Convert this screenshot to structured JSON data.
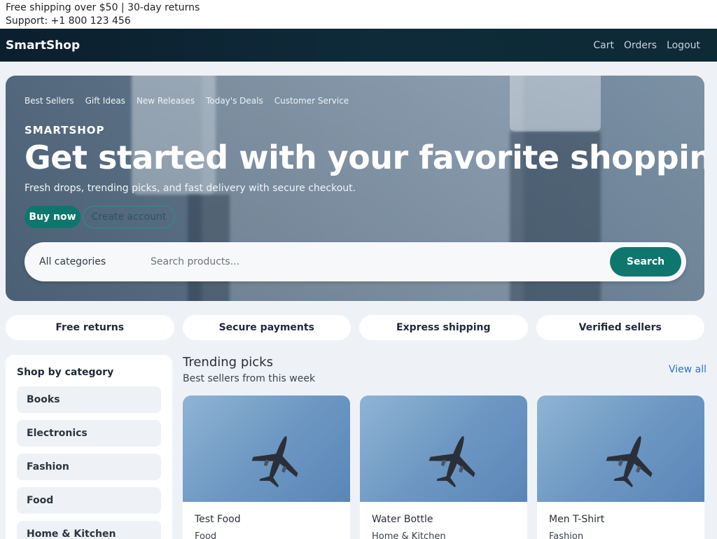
{
  "topinfo": {
    "line1": "Free shipping over $50 | 30-day returns",
    "line2": "Support: +1 800 123 456"
  },
  "navbar": {
    "brand": "SmartShop",
    "links": [
      "Cart",
      "Orders",
      "Logout"
    ]
  },
  "hero": {
    "links": [
      "Best Sellers",
      "Gift Ideas",
      "New Releases",
      "Today's Deals",
      "Customer Service"
    ],
    "kicker": "SMARTSHOP",
    "title": "Get started with your favorite shopping",
    "subtitle": "Fresh drops, trending picks, and fast delivery with secure checkout.",
    "buy_label": "Buy now",
    "create_label": "Create account"
  },
  "search": {
    "category": "All categories",
    "placeholder": "Search products...",
    "button": "Search"
  },
  "features": [
    "Free returns",
    "Secure payments",
    "Express shipping",
    "Verified sellers"
  ],
  "sidebar": {
    "title": "Shop by category",
    "items": [
      "Books",
      "Electronics",
      "Fashion",
      "Food",
      "Home & Kitchen"
    ]
  },
  "trending": {
    "title": "Trending picks",
    "subtitle": "Best sellers from this week",
    "view_all": "View all",
    "products": [
      {
        "name": "Test Food",
        "category": "Food"
      },
      {
        "name": "Water Bottle",
        "category": "Home & Kitchen"
      },
      {
        "name": "Men T-Shirt",
        "category": "Fashion"
      }
    ]
  },
  "colors": {
    "accent": "#0f766e",
    "nav_bg": "#0b1f2e",
    "link": "#2f6fd0"
  }
}
